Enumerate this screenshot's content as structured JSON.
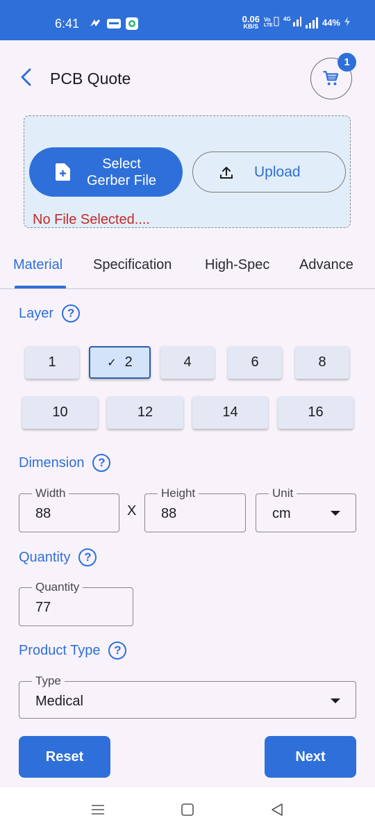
{
  "status_bar": {
    "time": "6:41",
    "speed_value": "0.06",
    "speed_unit": "KB/S",
    "battery": "44%"
  },
  "header": {
    "title": "PCB Quote",
    "cart_count": "1"
  },
  "upload": {
    "select_label": "Select\nGerber File",
    "upload_label": "Upload",
    "no_file_text": "No File Selected...."
  },
  "tabs": [
    {
      "label": "Material"
    },
    {
      "label": "Specification"
    },
    {
      "label": "High-Spec"
    },
    {
      "label": "Advance"
    }
  ],
  "layer": {
    "label": "Layer",
    "help": "?",
    "options": [
      "1",
      "2",
      "4",
      "6",
      "8",
      "10",
      "12",
      "14",
      "16"
    ],
    "selected": "2"
  },
  "dimension": {
    "label": "Dimension",
    "help": "?",
    "width_label": "Width",
    "width_value": "88",
    "separator": "X",
    "height_label": "Height",
    "height_value": "88",
    "unit_label": "Unit",
    "unit_value": "cm"
  },
  "quantity": {
    "label": "Quantity",
    "help": "?",
    "field_label": "Quantity",
    "value": "77"
  },
  "product_type": {
    "label": "Product Type",
    "help": "?",
    "field_label": "Type",
    "value": "Medical"
  },
  "actions": {
    "reset_label": "Reset",
    "next_label": "Next"
  },
  "colors": {
    "accent": "#2f6fd9",
    "error": "#c62828",
    "upload_bg": "#e1eef9",
    "background": "#f8f3fb"
  }
}
